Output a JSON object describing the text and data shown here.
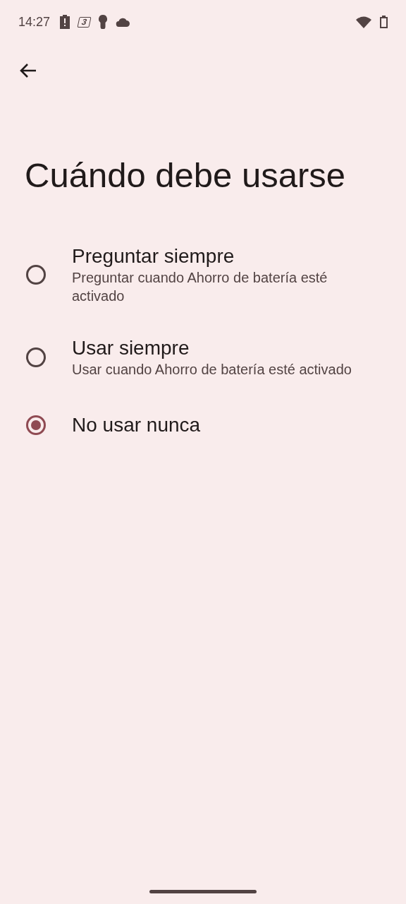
{
  "status_bar": {
    "time": "14:27",
    "badge": "3"
  },
  "title": "Cuándo debe usarse",
  "options": [
    {
      "label": "Preguntar siempre",
      "description": "Preguntar cuando Ahorro de batería esté activado",
      "selected": false
    },
    {
      "label": "Usar siempre",
      "description": "Usar cuando Ahorro de batería esté activado",
      "selected": false
    },
    {
      "label": "No usar nunca",
      "selected": true
    }
  ]
}
